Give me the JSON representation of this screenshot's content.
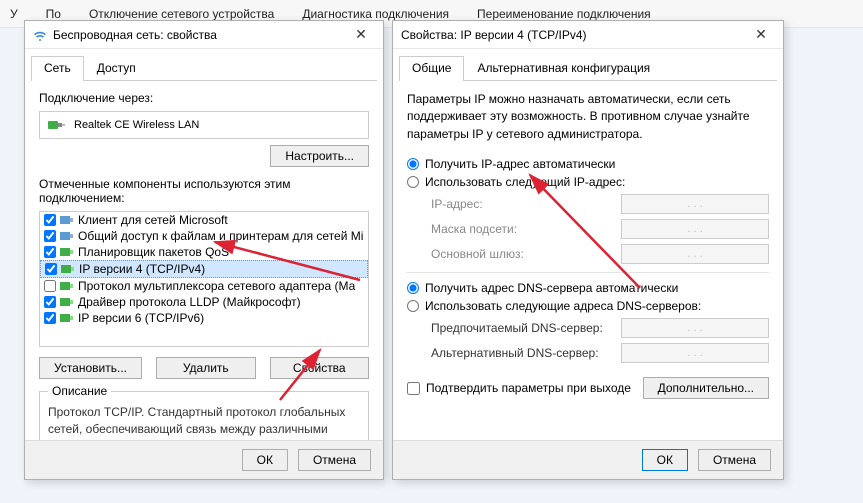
{
  "toolbar": {
    "items": [
      "У",
      "По",
      "Отключение сетевого устройства",
      "Диагностика подключения",
      "Переименование подключения"
    ]
  },
  "left": {
    "title": "Беспроводная сеть: свойства",
    "tabs": {
      "net": "Сеть",
      "access": "Доступ"
    },
    "connect_via": "Подключение через:",
    "adapter": "Realtek          CE Wireless LAN",
    "configure": "Настроить...",
    "components_label": "Отмеченные компоненты используются этим подключением:",
    "items": [
      {
        "chk": true,
        "label": "Клиент для сетей Microsoft"
      },
      {
        "chk": true,
        "label": "Общий доступ к файлам и принтерам для сетей Mi"
      },
      {
        "chk": true,
        "label": "Планировщик пакетов QoS"
      },
      {
        "chk": true,
        "label": "IP версии 4 (TCP/IPv4)",
        "selected": true
      },
      {
        "chk": false,
        "label": "Протокол мультиплексора сетевого адаптера (Ма"
      },
      {
        "chk": true,
        "label": "Драйвер протокола LLDP (Майкрософт)"
      },
      {
        "chk": true,
        "label": "IP версии 6 (TCP/IPv6)"
      }
    ],
    "install": "Установить...",
    "uninstall": "Удалить",
    "properties": "Свойства",
    "desc_title": "Описание",
    "desc_body": "Протокол TCP/IP. Стандартный протокол глобальных сетей, обеспечивающий связь между различными взаимодействующими сетями.",
    "ok": "ОК",
    "cancel": "Отмена"
  },
  "right": {
    "title": "Свойства: IP версии 4 (TCP/IPv4)",
    "tabs": {
      "general": "Общие",
      "alt": "Альтернативная конфигурация"
    },
    "intro": "Параметры IP можно назначать автоматически, если сеть поддерживает эту возможность. В противном случае узнайте параметры IP у сетевого администратора.",
    "ip_auto": "Получить IP-адрес автоматически",
    "ip_manual": "Использовать следующий IP-адрес:",
    "ip_addr": "IP-адрес:",
    "mask": "Маска подсети:",
    "gateway": "Основной шлюз:",
    "dns_auto": "Получить адрес DNS-сервера автоматически",
    "dns_manual": "Использовать следующие адреса DNS-серверов:",
    "dns_pref": "Предпочитаемый DNS-сервер:",
    "dns_alt": "Альтернативный DNS-сервер:",
    "dots": ".       .       .",
    "validate": "Подтвердить параметры при выходе",
    "advanced": "Дополнительно...",
    "ok": "ОК",
    "cancel": "Отмена"
  }
}
